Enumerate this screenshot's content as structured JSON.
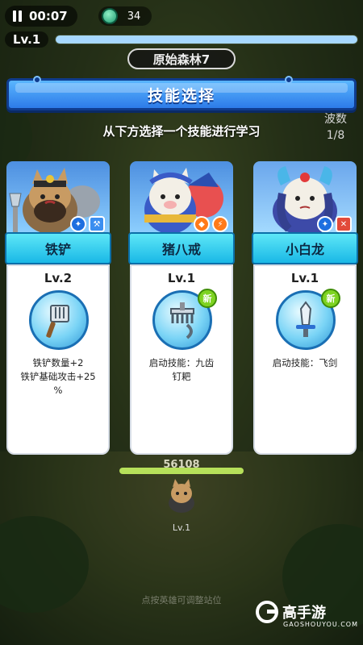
{
  "hud": {
    "timer": "00:07",
    "coins": "34",
    "level": "Lv.1",
    "xp_fraction": 1.0
  },
  "stage": {
    "name": "原始森林7"
  },
  "wave": {
    "label": "波数",
    "value": "1/8"
  },
  "dialog": {
    "title": "技能选择",
    "subtitle": "从下方选择一个技能进行学习"
  },
  "cards": [
    {
      "hero": "铁铲",
      "level": "Lv.2",
      "is_new": false,
      "description_lines": [
        "铁铲数量+2",
        "铁铲基础攻击+25",
        "%"
      ],
      "icon": "shovel-icon",
      "badges": [
        "blue",
        "sky"
      ]
    },
    {
      "hero": "猪八戒",
      "level": "Lv.1",
      "is_new": true,
      "new_label": "新",
      "description_lines": [
        "启动技能：九齿",
        "钉耙"
      ],
      "icon": "rake-icon",
      "badges": [
        "orange",
        "orange"
      ]
    },
    {
      "hero": "小白龙",
      "level": "Lv.1",
      "is_new": true,
      "new_label": "新",
      "description_lines": [
        "启动技能：飞剑"
      ],
      "icon": "sword-icon",
      "badges": [
        "blue",
        "red"
      ]
    }
  ],
  "hero_area": {
    "power": "56108",
    "level": "Lv.1",
    "hint": "点按英雄可调整站位"
  },
  "watermark": {
    "name": "高手游",
    "site": "GAOSHOUYOU.COM"
  },
  "colors": {
    "banner": "#2d7be8",
    "name_bar": "#19b8e6",
    "new_tag": "#7ed321"
  }
}
